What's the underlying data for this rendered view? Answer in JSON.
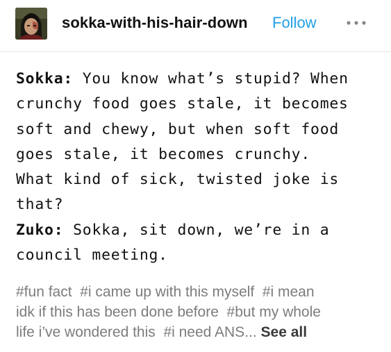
{
  "post": {
    "username": "sokka-with-his-hair-down",
    "follow_label": "Follow",
    "more_icon": "more-horizontal-icon",
    "avatar": "avatar-image",
    "dialogue": [
      {
        "speaker": "Sokka:",
        "lines": [
          " You know what’s stupid? When",
          "crunchy food goes stale, it becomes",
          "soft and chewy, but when soft food",
          "goes stale, it becomes crunchy.",
          "What kind of sick, twisted joke is",
          "that?"
        ]
      },
      {
        "speaker": "Zuko:",
        "lines": [
          " Sokka, sit down, we’re in a",
          "council meeting."
        ]
      }
    ],
    "tags_lines": [
      "#fun fact  #i came up with this myself  #i mean",
      "idk if this has been done before  #but my whole",
      "life i’ve wondered this  #i need ANS... "
    ],
    "see_all_label": "See all"
  },
  "colors": {
    "follow": "#1f9fe5",
    "tags": "#7c7c7c",
    "divider": "#e4e4e4"
  }
}
